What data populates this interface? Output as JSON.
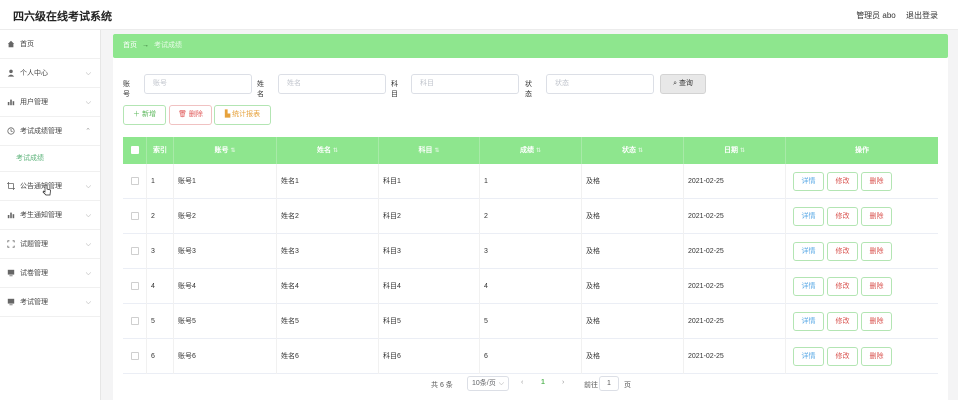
{
  "header": {
    "title": "四六级在线考试系统",
    "user": "管理员 abo",
    "logout": "退出登录"
  },
  "sidebar": {
    "items": [
      {
        "label": "首页",
        "icon": "home-icon"
      },
      {
        "label": "个人中心",
        "icon": "user-icon"
      },
      {
        "label": "用户管理",
        "icon": "chart-icon"
      },
      {
        "label": "考试成绩管理",
        "icon": "clock-icon"
      },
      {
        "label": "考试成绩",
        "icon": ""
      },
      {
        "label": "公告通知管理",
        "icon": "crop-icon"
      },
      {
        "label": "考生通知管理",
        "icon": "chart-icon"
      },
      {
        "label": "试题管理",
        "icon": "frame-icon"
      },
      {
        "label": "试卷管理",
        "icon": "monitor-icon"
      },
      {
        "label": "考试管理",
        "icon": "monitor-icon"
      }
    ]
  },
  "breadcrumb": {
    "home": "首页",
    "arrow": "→",
    "current": "考试成绩"
  },
  "search": {
    "account_label": "账号",
    "account_placeholder": "账号",
    "name_label": "姓名",
    "name_placeholder": "姓名",
    "subject_label": "科目",
    "subject_placeholder": "科目",
    "status_label": "状态",
    "status_placeholder": "状态",
    "search_button": "查询"
  },
  "actions": {
    "add": "新增",
    "delete": "删除",
    "stats": "统计报表"
  },
  "table": {
    "headers": [
      "索引",
      "账号",
      "姓名",
      "科目",
      "成绩",
      "状态",
      "日期",
      "操作"
    ],
    "row_buttons": {
      "detail": "详情",
      "edit": "修改",
      "remove": "删除"
    },
    "rows": [
      {
        "index": "1",
        "account": "账号1",
        "name": "姓名1",
        "subject": "科目1",
        "score": "1",
        "status": "及格",
        "date": "2021-02-25"
      },
      {
        "index": "2",
        "account": "账号2",
        "name": "姓名2",
        "subject": "科目2",
        "score": "2",
        "status": "及格",
        "date": "2021-02-25"
      },
      {
        "index": "3",
        "account": "账号3",
        "name": "姓名3",
        "subject": "科目3",
        "score": "3",
        "status": "及格",
        "date": "2021-02-25"
      },
      {
        "index": "4",
        "account": "账号4",
        "name": "姓名4",
        "subject": "科目4",
        "score": "4",
        "status": "及格",
        "date": "2021-02-25"
      },
      {
        "index": "5",
        "account": "账号5",
        "name": "姓名5",
        "subject": "科目5",
        "score": "5",
        "status": "及格",
        "date": "2021-02-25"
      },
      {
        "index": "6",
        "account": "账号6",
        "name": "姓名6",
        "subject": "科目6",
        "score": "6",
        "status": "及格",
        "date": "2021-02-25"
      }
    ]
  },
  "pagination": {
    "total": "共 6 条",
    "page_size": "10条/页",
    "current_page": "1",
    "goto_prefix": "前往",
    "goto_value": "1",
    "goto_suffix": "页"
  },
  "colors": {
    "accent": "#8ee68e",
    "success": "#5cb85c",
    "danger": "#d9534f"
  }
}
